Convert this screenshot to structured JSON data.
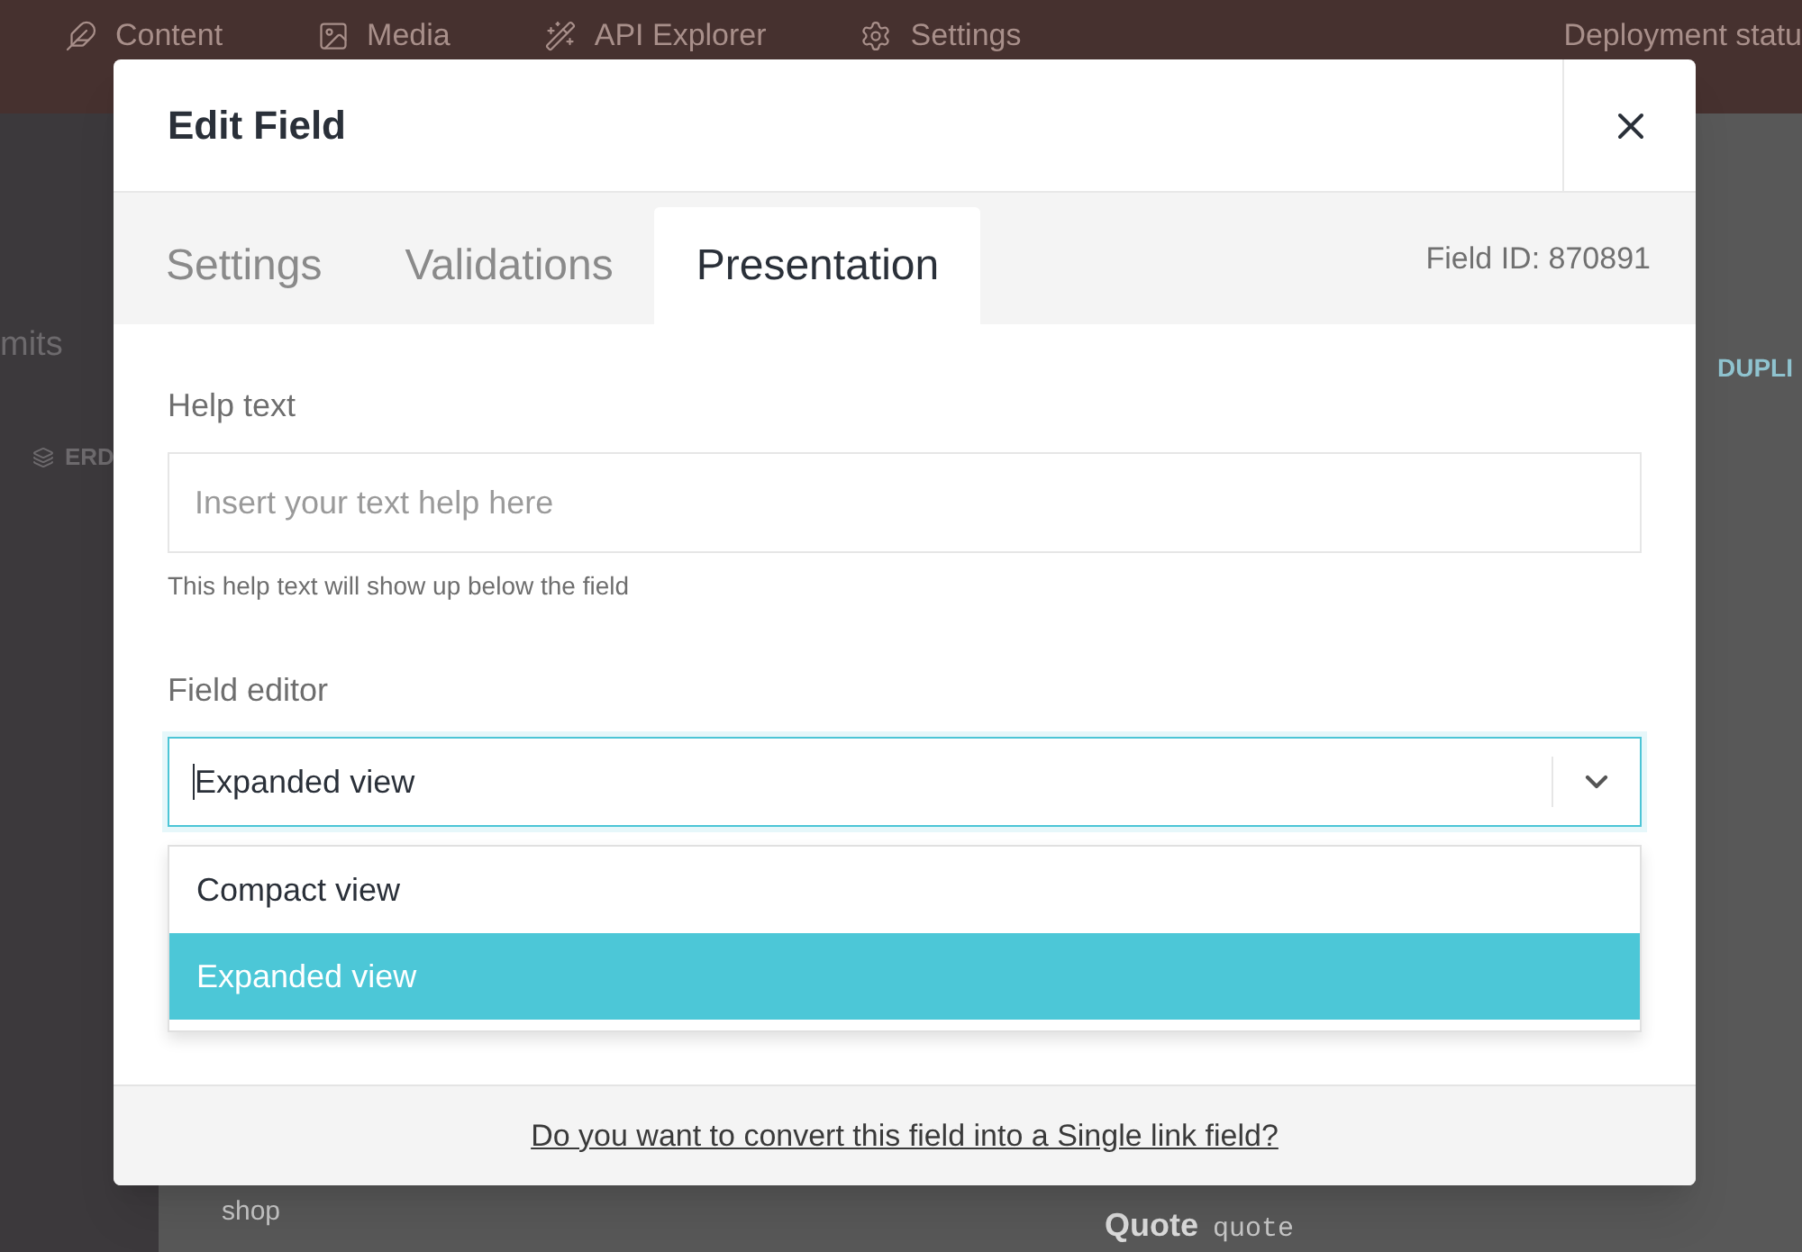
{
  "background": {
    "nav": [
      {
        "label": "Content"
      },
      {
        "label": "Media"
      },
      {
        "label": "API Explorer"
      },
      {
        "label": "Settings"
      }
    ],
    "deployment_status": "Deployment statu",
    "side_heading": "mits",
    "side_tab": "ERD",
    "action": "DUPLI",
    "list_item": "shop",
    "entry_title": "Quote",
    "entry_code": "quote"
  },
  "modal": {
    "title": "Edit Field",
    "tabs": [
      {
        "label": "Settings",
        "selected": false
      },
      {
        "label": "Validations",
        "selected": false
      },
      {
        "label": "Presentation",
        "selected": true
      }
    ],
    "field_id": "Field ID: 870891",
    "help_text": {
      "label": "Help text",
      "placeholder": "Insert your text help here",
      "hint": "This help text will show up below the field"
    },
    "field_editor": {
      "label": "Field editor",
      "value": "Expanded view",
      "expanded": true,
      "options": [
        {
          "label": "Compact view",
          "selected": false
        },
        {
          "label": "Expanded view",
          "selected": true
        }
      ]
    },
    "footer_link": "Do you want to convert this field into a Single link field?"
  }
}
